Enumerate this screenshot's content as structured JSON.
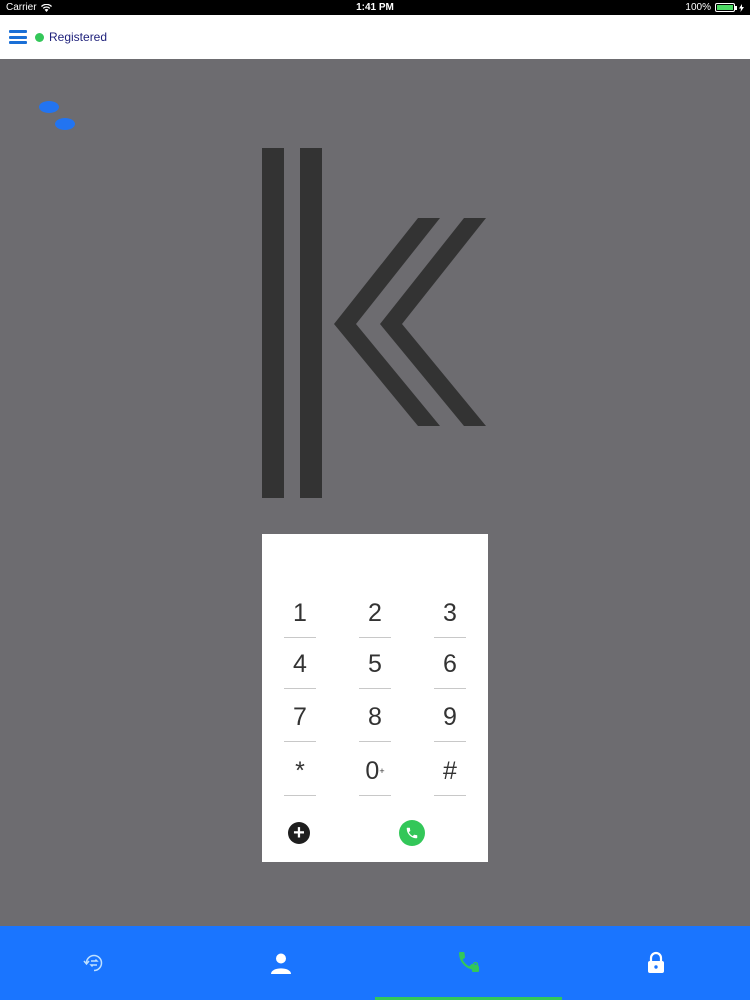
{
  "status_bar": {
    "carrier": "Carrier",
    "time": "1:41 PM",
    "battery": "100%"
  },
  "header": {
    "status_label": "Registered",
    "status_color": "#34c759",
    "menu_icon": "hamburger-icon"
  },
  "logo": {
    "icon": "k-logo"
  },
  "dialpad": {
    "keys": [
      {
        "label": "1"
      },
      {
        "label": "2"
      },
      {
        "label": "3"
      },
      {
        "label": "4"
      },
      {
        "label": "5"
      },
      {
        "label": "6"
      },
      {
        "label": "7"
      },
      {
        "label": "8"
      },
      {
        "label": "9"
      },
      {
        "label": "*"
      },
      {
        "label": "0",
        "sup": "+"
      },
      {
        "label": "#"
      }
    ],
    "add_icon": "plus-circle-icon",
    "call_icon": "phone-icon",
    "call_color": "#33c759"
  },
  "bottom_nav": {
    "items": [
      {
        "icon": "recents-icon"
      },
      {
        "icon": "contacts-icon"
      },
      {
        "icon": "dialer-icon",
        "active": true
      },
      {
        "icon": "lock-icon"
      }
    ],
    "background": "#1a75ff",
    "active_color": "#33c759"
  }
}
